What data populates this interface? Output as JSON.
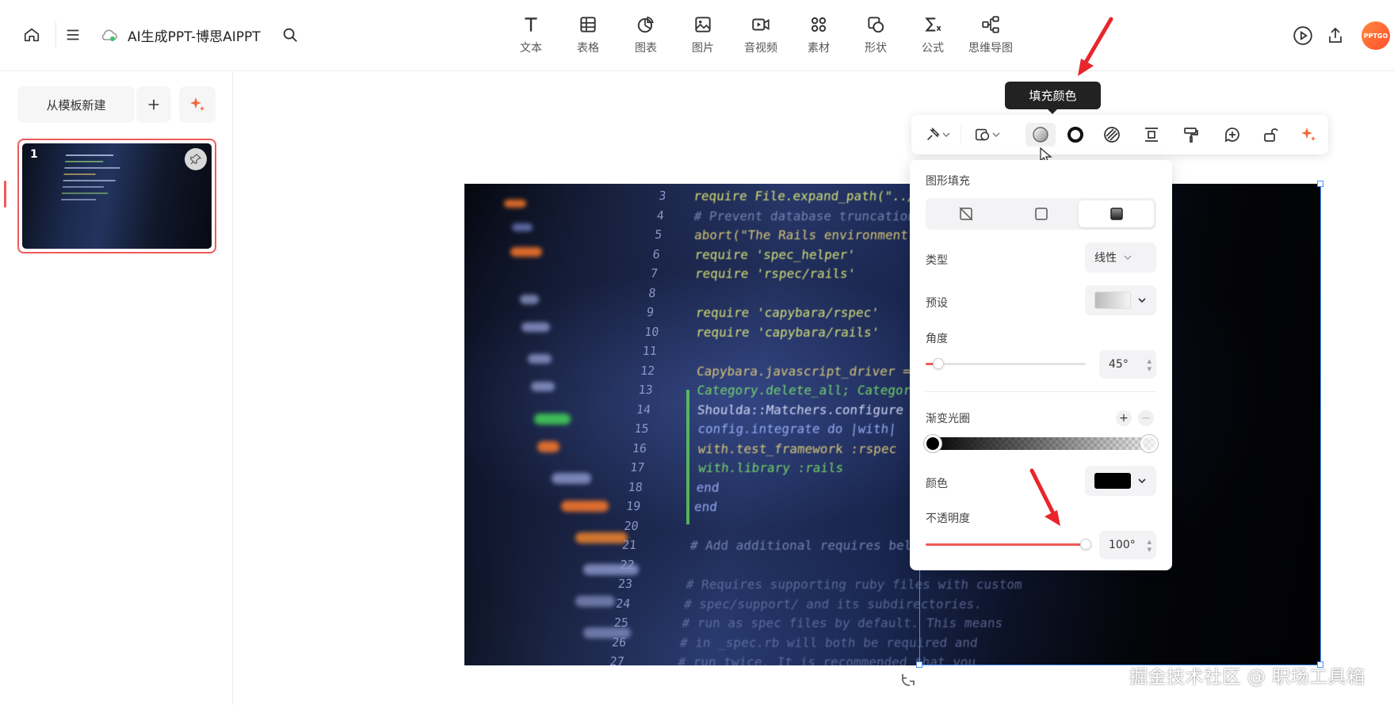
{
  "header": {
    "title": "AI生成PPT-博思AIPPT",
    "tools": [
      {
        "label": "文本",
        "icon": "text-icon"
      },
      {
        "label": "表格",
        "icon": "table-icon"
      },
      {
        "label": "图表",
        "icon": "chart-icon"
      },
      {
        "label": "图片",
        "icon": "image-icon"
      },
      {
        "label": "音视频",
        "icon": "video-icon"
      },
      {
        "label": "素材",
        "icon": "assets-icon"
      },
      {
        "label": "形状",
        "icon": "shape-icon"
      },
      {
        "label": "公式",
        "icon": "formula-icon"
      },
      {
        "label": "思维导图",
        "icon": "mindmap-icon"
      }
    ],
    "avatar_text": "PPTGO"
  },
  "sidebar": {
    "new_from_template": "从模板新建",
    "slides": [
      {
        "number": "1"
      }
    ]
  },
  "tooltip": {
    "text": "填充颜色"
  },
  "fill_panel": {
    "section_title": "图形填充",
    "type_label": "类型",
    "type_value": "线性",
    "preset_label": "预设",
    "angle_label": "角度",
    "angle_value": "45°",
    "angle_fraction": 0.08,
    "gradient_label": "渐变光圈",
    "color_label": "颜色",
    "color_value": "#000000",
    "opacity_label": "不透明度",
    "opacity_value": "100°",
    "opacity_fraction": 1.0
  },
  "canvas": {
    "code_lines": [
      {
        "n": "3",
        "text": "require File.expand_path(\"../../config/environment\""
      },
      {
        "n": "4",
        "text": "# Prevent database truncation if the environment"
      },
      {
        "n": "5",
        "text": "abort(\"The Rails environment is running in product"
      },
      {
        "n": "6",
        "text": "require 'spec_helper'"
      },
      {
        "n": "7",
        "text": "require 'rspec/rails'"
      },
      {
        "n": "8",
        "text": ""
      },
      {
        "n": "9",
        "text": "require 'capybara/rspec'"
      },
      {
        "n": "10",
        "text": "require 'capybara/rails'"
      },
      {
        "n": "11",
        "text": ""
      },
      {
        "n": "12",
        "text": "Capybara.javascript_driver = :webkit"
      },
      {
        "n": "13",
        "text": "Category.delete_all; Category"
      },
      {
        "n": "14",
        "text": "Shoulda::Matchers.configure do |config|"
      },
      {
        "n": "15",
        "text": "config.integrate do |with|"
      },
      {
        "n": "16",
        "text": "with.test_framework :rspec"
      },
      {
        "n": "17",
        "text": "with.library :rails"
      },
      {
        "n": "18",
        "text": "end"
      },
      {
        "n": "19",
        "text": "end"
      },
      {
        "n": "20",
        "text": ""
      },
      {
        "n": "21",
        "text": "# Add additional requires below this line"
      },
      {
        "n": "22",
        "text": ""
      },
      {
        "n": "23",
        "text": "# Requires supporting ruby files with custom"
      },
      {
        "n": "24",
        "text": "# spec/support/ and its subdirectories."
      },
      {
        "n": "25",
        "text": "# run as spec files by default. This means"
      },
      {
        "n": "26",
        "text": "# in _spec.rb will both be required and"
      },
      {
        "n": "27",
        "text": "# run twice. It is recommended that you"
      }
    ]
  },
  "watermark": "掘金技术社区 @ 职场工具箱",
  "colors": {
    "accent": "#f05a5a",
    "selection": "#4a90ff",
    "arrow": "#e8262b"
  }
}
